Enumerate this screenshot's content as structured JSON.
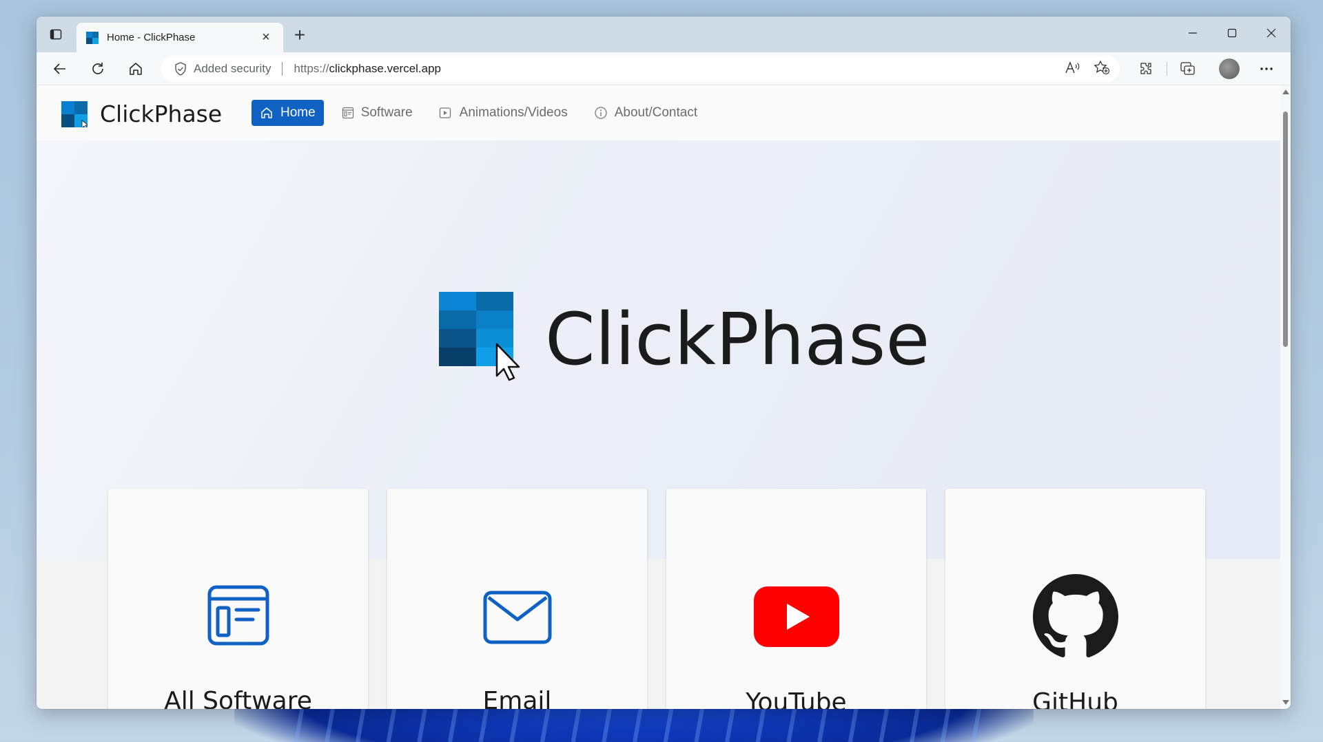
{
  "browser": {
    "tab": {
      "title": "Home - ClickPhase"
    },
    "address_bar": {
      "security_label": "Added security",
      "url_protocol": "https://",
      "url_host": "clickphase.vercel.app"
    }
  },
  "site": {
    "brand": "ClickPhase",
    "nav": [
      {
        "label": "Home",
        "icon": "home-icon",
        "active": true
      },
      {
        "label": "Software",
        "icon": "window-icon",
        "active": false
      },
      {
        "label": "Animations/Videos",
        "icon": "video-icon",
        "active": false
      },
      {
        "label": "About/Contact",
        "icon": "info-icon",
        "active": false
      }
    ],
    "hero_title": "ClickPhase",
    "cards": [
      {
        "label": "All Software",
        "icon": "software-window-icon"
      },
      {
        "label": "Email",
        "icon": "envelope-icon"
      },
      {
        "label": "YouTube",
        "icon": "youtube-icon"
      },
      {
        "label": "GitHub",
        "icon": "github-icon"
      }
    ]
  },
  "colors": {
    "accent": "#0f62c4",
    "brand_blue": "#0a7fd0",
    "youtube_red": "#ff0000",
    "github_black": "#1b1b1b"
  }
}
